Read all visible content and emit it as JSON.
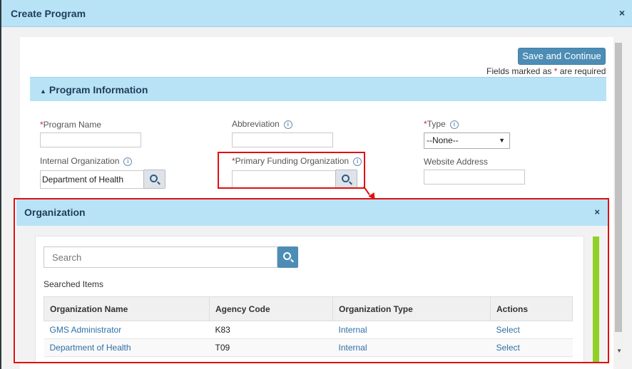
{
  "modal": {
    "title": "Create Program",
    "close": "×",
    "save_label": "Save and Continue",
    "required_note_pre": "Fields marked as ",
    "required_star": "*",
    "required_note_post": " are required"
  },
  "section": {
    "arrow": "▲",
    "title": "Program Information"
  },
  "form": {
    "program_name_label": "Program Name",
    "abbreviation_label": "Abbreviation",
    "type_label": "Type",
    "type_value": "--None--",
    "internal_org_label": "Internal Organization",
    "internal_org_value": "Department of Health",
    "primary_funding_label": "Primary Funding Organization",
    "website_label": "Website Address",
    "info_glyph": "i",
    "required_star": "*"
  },
  "org_dialog": {
    "title": "Organization",
    "close": "×",
    "search_placeholder": "Search",
    "searched_label": "Searched Items",
    "columns": [
      "Organization Name",
      "Agency Code",
      "Organization Type",
      "Actions"
    ],
    "rows": [
      {
        "name": "GMS Administrator",
        "code": "K83",
        "type": "Internal",
        "action": "Select"
      },
      {
        "name": "Department of Health",
        "code": "T09",
        "type": "Internal",
        "action": "Select"
      }
    ]
  },
  "scrollbar": {
    "arrow_down": "▼"
  },
  "colors": {
    "header_bg": "#b8e3f7",
    "accent_button": "#4d8db5",
    "highlight_red": "#e01010",
    "scroll_indicator": "#8fd128"
  }
}
